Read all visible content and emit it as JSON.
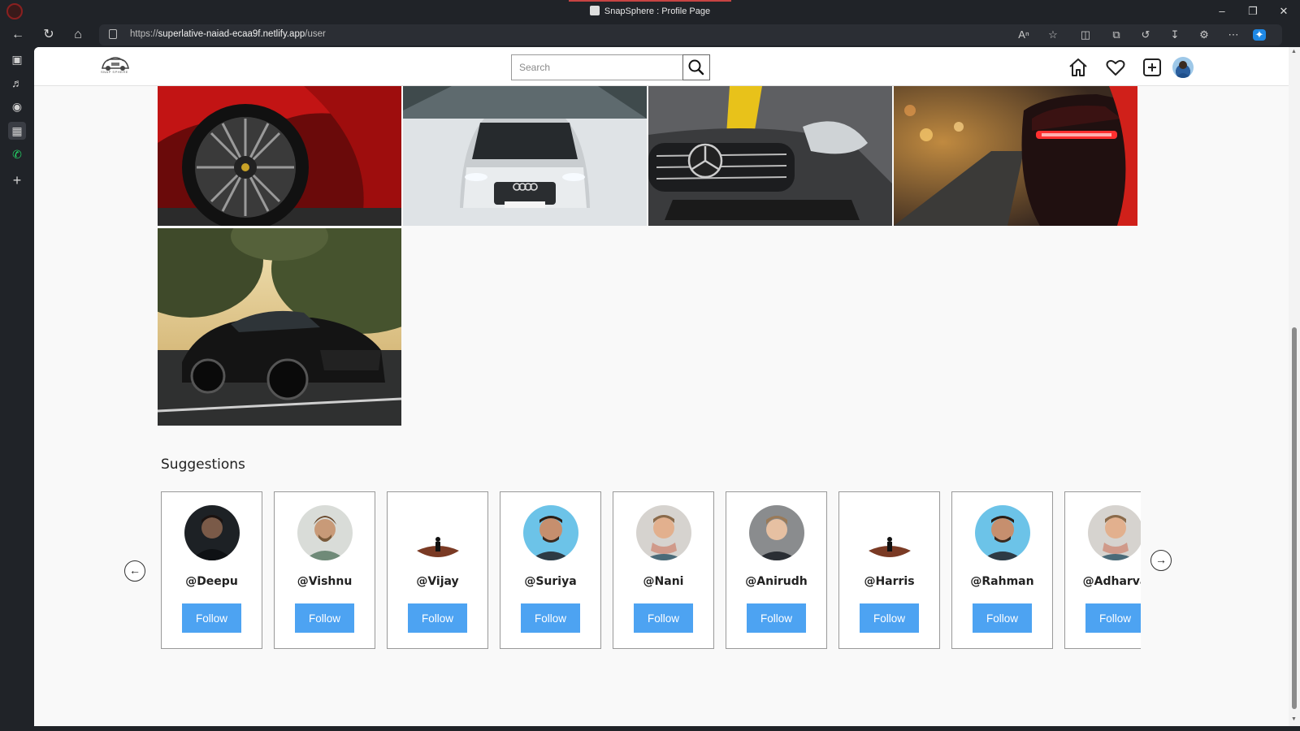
{
  "browser": {
    "tab_title": "SnapSphere : Profile Page",
    "url_prefix": "https://",
    "url_host": "superlative-naiad-ecaa9f.netlify.app",
    "url_path": "/user"
  },
  "header": {
    "logo_text": "SNAP SPHERE",
    "search_placeholder": "Search"
  },
  "photos": [
    {
      "subject": "red-sports-car-wheel"
    },
    {
      "subject": "white-audi-in-snow"
    },
    {
      "subject": "grey-mercedes-front"
    },
    {
      "subject": "red-car-taillights"
    },
    {
      "subject": "black-mustang-at-sunset"
    }
  ],
  "suggestions": {
    "title": "Suggestions",
    "users": [
      {
        "handle": "@Deepu",
        "follow_label": "Follow"
      },
      {
        "handle": "@Vishnu",
        "follow_label": "Follow"
      },
      {
        "handle": "@Vijay",
        "follow_label": "Follow"
      },
      {
        "handle": "@Suriya",
        "follow_label": "Follow"
      },
      {
        "handle": "@Nani",
        "follow_label": "Follow"
      },
      {
        "handle": "@Anirudh",
        "follow_label": "Follow"
      },
      {
        "handle": "@Harris",
        "follow_label": "Follow"
      },
      {
        "handle": "@Rahman",
        "follow_label": "Follow"
      },
      {
        "handle": "@Adharva",
        "follow_label": "Follow"
      }
    ]
  },
  "colors": {
    "follow_button": "#4da3f2",
    "page_background": "#f9f9f9",
    "browser_chrome": "#202328"
  }
}
